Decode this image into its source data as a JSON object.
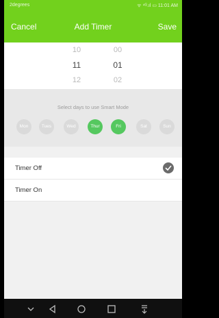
{
  "status_bar": {
    "carrier": "2degrees",
    "indicators": "ᯤ ⁴ᴳ.ıl ▭ 11:01 AM"
  },
  "app_bar": {
    "cancel": "Cancel",
    "title": "Add Timer",
    "save": "Save"
  },
  "time_picker": {
    "hours": [
      "10",
      "11",
      "12"
    ],
    "minutes": [
      "00",
      "01",
      "02"
    ],
    "selected_hour": "11",
    "selected_minute": "01"
  },
  "days": {
    "label": "Select days to use Smart Mode",
    "items": [
      {
        "label": "Mon",
        "selected": false
      },
      {
        "label": "Tues",
        "selected": false
      },
      {
        "label": "Wed",
        "selected": false
      },
      {
        "label": "Thur",
        "selected": true
      },
      {
        "label": "Fri",
        "selected": true
      },
      {
        "label": "Sat",
        "selected": false
      },
      {
        "label": "Sun",
        "selected": false
      }
    ]
  },
  "options": [
    {
      "label": "Timer Off",
      "checked": true
    },
    {
      "label": "Timer On",
      "checked": false
    }
  ],
  "colors": {
    "accent": "#72d11d",
    "day_selected": "#55c85f",
    "day_unselected": "#dadada"
  },
  "nav_icons": [
    "chevron-down-icon",
    "back-icon",
    "home-icon",
    "recents-icon",
    "notification-pull-icon"
  ]
}
